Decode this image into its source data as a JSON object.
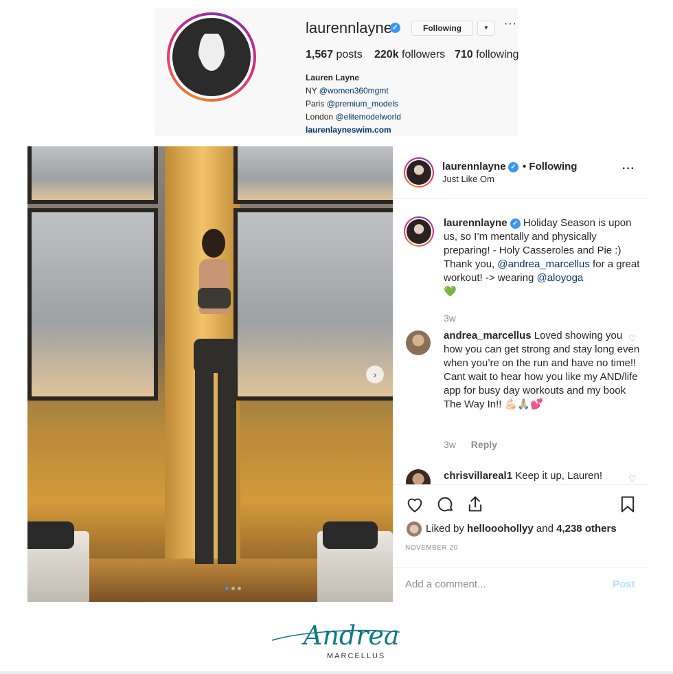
{
  "profile": {
    "username": "laurennlayne",
    "follow_button": "Following",
    "dropdown_icon": "chevron-down-icon",
    "more_icon": "more-icon",
    "stats": {
      "posts_count": "1,567",
      "posts_label": "posts",
      "followers_count": "220k",
      "followers_label": "followers",
      "following_count": "710",
      "following_label": "following"
    },
    "bio": {
      "name": "Lauren Layne",
      "line1_city": "NY",
      "line1_handle": "@women360mgmt",
      "line2_city": "Paris",
      "line2_handle": "@premium_models",
      "line3_city": "London",
      "line3_handle": "@elitemodelworld",
      "website": "laurenlayneswim.com"
    }
  },
  "post": {
    "header": {
      "username": "laurennlayne",
      "follow_status": "• Following",
      "location": "Just Like Om"
    },
    "caption": {
      "username": "laurennlayne",
      "text_part1": "Holiday Season is upon us, so I’m mentally and physically preparing! - Holy Casseroles and Pie :) Thank you,",
      "mention1": "@andrea_marcellus",
      "text_part2": "for a great workout! -> wearing",
      "mention2": "@aloyoga",
      "emoji": "💚",
      "time": "3w"
    },
    "comments": [
      {
        "username": "andrea_marcellus",
        "text": "Loved showing you how you can get strong and stay long even when you’re on the run and have no time!! Cant wait to hear how you like my AND/life app for busy day workouts and my book The Way In!! 💪🏻🙏🏼💕",
        "time": "3w",
        "reply_label": "Reply"
      },
      {
        "username": "chrisvillareal1",
        "text": "Keep it up, Lauren!"
      }
    ],
    "likes": {
      "prefix": "Liked by",
      "liker": "hellooohollyy",
      "middle": "and",
      "others": "4,238 others"
    },
    "date": "NOVEMBER 20",
    "add_comment_placeholder": "Add a comment...",
    "post_button": "Post",
    "carousel": {
      "total": 3,
      "active": 1
    }
  },
  "logo": {
    "script": "Andrea",
    "sub": "MARCELLUS"
  },
  "colors": {
    "link": "#003569",
    "verified": "#3897f0",
    "muted": "#8e8e8e",
    "post_button": "#b2dffc",
    "logo": "#0f7a86"
  }
}
